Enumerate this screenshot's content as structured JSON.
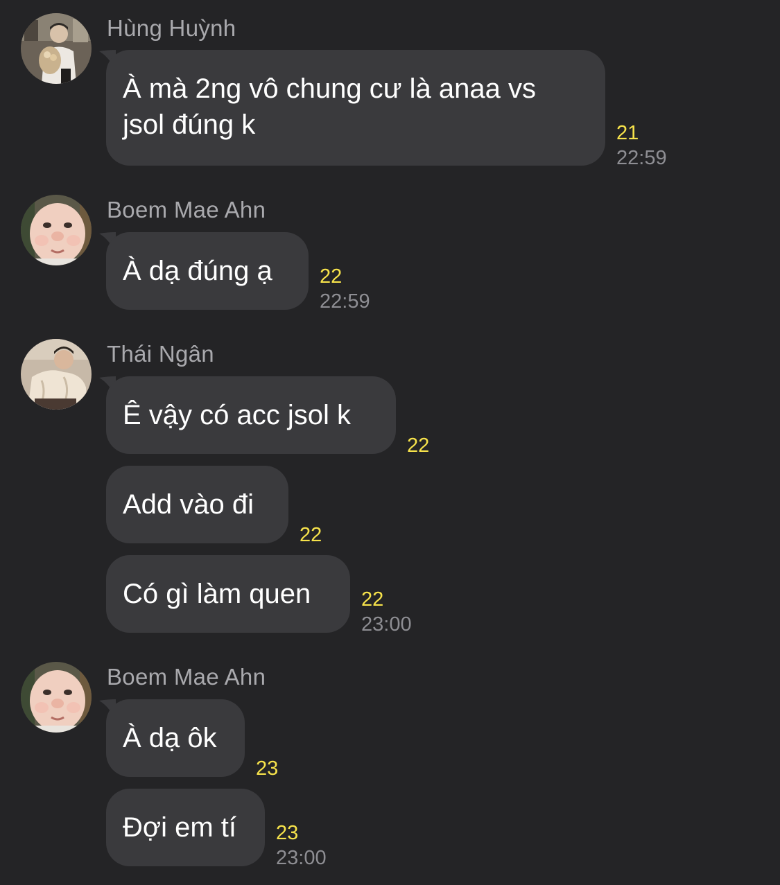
{
  "colors": {
    "background": "#242426",
    "bubble": "#3a3a3d",
    "sender_name": "#a9a9ad",
    "unread_count": "#f7e34b",
    "timestamp": "#8e8e93"
  },
  "groups": [
    {
      "sender": "Hùng Huỳnh",
      "avatar_icon": "person-with-bouquet-avatar",
      "messages": [
        {
          "text_line1": "À mà 2ng vô chung cư là anaa vs",
          "text_line2": "jsol đúng k",
          "count": "21",
          "time": "22:59"
        }
      ]
    },
    {
      "sender": "Boem Mae Ahn",
      "avatar_icon": "baby-face-avatar",
      "messages": [
        {
          "text": "À dạ đúng ạ",
          "count": "22",
          "time": "22:59"
        }
      ]
    },
    {
      "sender": "Thái Ngân",
      "avatar_icon": "person-in-cream-jacket-avatar",
      "messages": [
        {
          "text": "Ê vậy có acc jsol k",
          "count": "22"
        },
        {
          "text": "Add vào đi",
          "count": "22"
        },
        {
          "text": "Có gì làm quen",
          "count": "22",
          "time": "23:00"
        }
      ]
    },
    {
      "sender": "Boem Mae Ahn",
      "avatar_icon": "baby-face-avatar",
      "messages": [
        {
          "text": "À dạ ôk",
          "count": "23"
        },
        {
          "text": "Đợi em tí",
          "count": "23",
          "time": "23:00"
        }
      ]
    }
  ]
}
